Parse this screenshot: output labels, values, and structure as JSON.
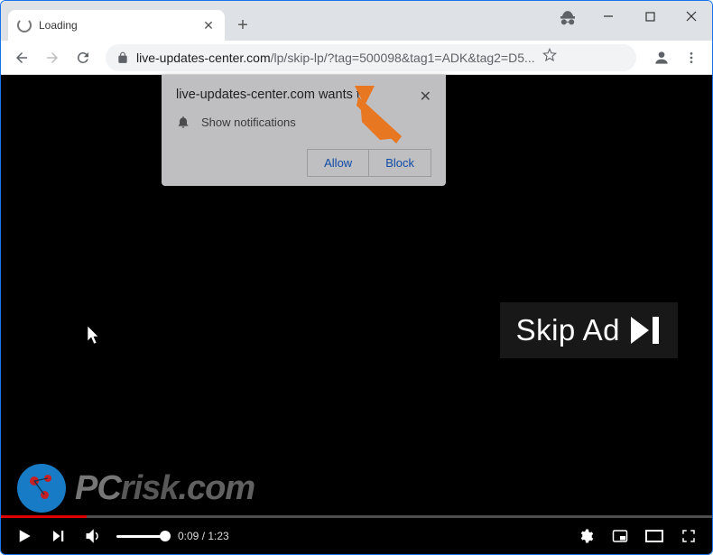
{
  "window": {
    "tab_title": "Loading",
    "minimize": "–",
    "maximize": "▢",
    "close": "✕"
  },
  "toolbar": {
    "url_domain": "live-updates-center.com",
    "url_path": "/lp/skip-lp/?tag=500098&tag1=ADK&tag2=D5..."
  },
  "notification": {
    "title": "live-updates-center.com wants to",
    "body": "Show notifications",
    "allow": "Allow",
    "block": "Block"
  },
  "skip_ad": {
    "label": "Skip Ad"
  },
  "player": {
    "current_time": "0:09",
    "duration": "1:23",
    "separator": " / "
  },
  "watermark": {
    "text_pc": "PC",
    "text_risk": "risk",
    "text_dot": ".",
    "text_com": "com"
  },
  "icons": {
    "new_tab": "+",
    "tab_close": "✕",
    "notif_close": "✕"
  }
}
